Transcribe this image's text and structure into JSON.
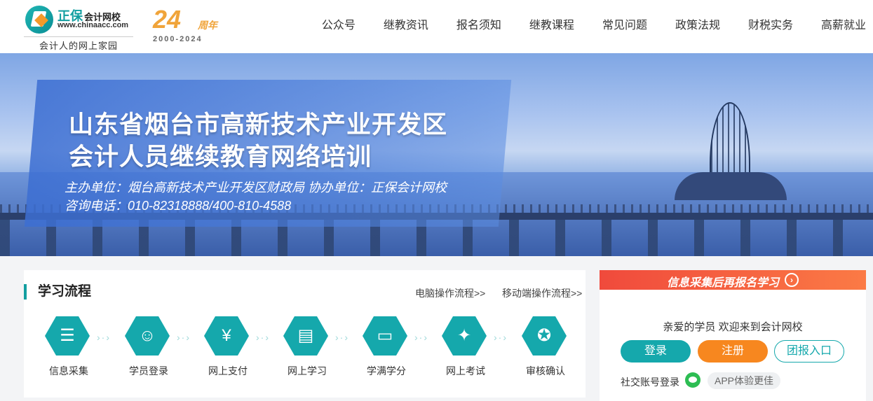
{
  "header": {
    "logo": {
      "name": "正保",
      "name_suffix": "会计网校",
      "url": "www.chinaacc.com",
      "slogan": "会计人的网上家园"
    },
    "anniversary": {
      "number": "24",
      "unit": "周年",
      "years": "2000-2024"
    },
    "nav": [
      "公众号",
      "继教资讯",
      "报名须知",
      "继教课程",
      "常见问题",
      "政策法规",
      "财税实务",
      "高薪就业"
    ]
  },
  "banner": {
    "title_line1": "山东省烟台市高新技术产业开发区",
    "title_line2": "会计人员继续教育网络培训",
    "organizer_line": "主办单位：烟台高新技术产业开发区财政局   协办单位：正保会计网校",
    "contact_line": "咨询电话：010-82318888/400-810-4588"
  },
  "process": {
    "title": "学习流程",
    "pc_link": "电脑操作流程>>",
    "mobile_link": "移动端操作流程>>",
    "arrow": "›·›",
    "steps": [
      {
        "label": "信息采集",
        "icon": "form-icon",
        "glyph": "☰"
      },
      {
        "label": "学员登录",
        "icon": "user-check-icon",
        "glyph": "☺"
      },
      {
        "label": "网上支付",
        "icon": "money-bag-icon",
        "glyph": "¥"
      },
      {
        "label": "网上学习",
        "icon": "study-card-icon",
        "glyph": "▤"
      },
      {
        "label": "学满学分",
        "icon": "monitor-icon",
        "glyph": "▭"
      },
      {
        "label": "网上考试",
        "icon": "thumbs-up-icon",
        "glyph": "✦"
      },
      {
        "label": "审核确认",
        "icon": "medal-icon",
        "glyph": "✪"
      }
    ]
  },
  "sidebar": {
    "header": "信息采集后再报名学习",
    "header_arrow": "›",
    "welcome": "亲爱的学员 欢迎来到会计网校",
    "login": "登录",
    "register": "注册",
    "group": "团报入口",
    "social_label": "社交账号登录",
    "app_tag": "APP体验更佳"
  },
  "colors": {
    "accent": "#15a8ac",
    "orange": "#f7871f",
    "red": "#f04a3c"
  }
}
